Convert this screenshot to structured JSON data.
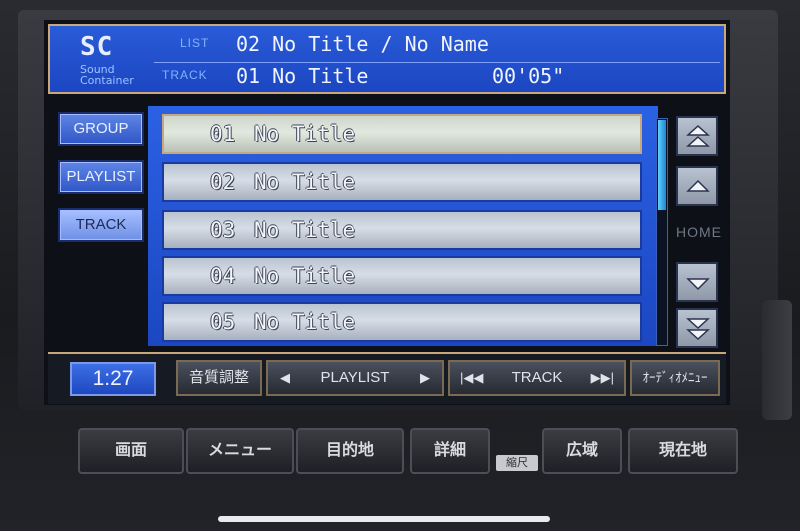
{
  "header": {
    "logo": "SC",
    "logo_sub_1": "Sound",
    "logo_sub_2": "Container",
    "list_label": "LIST",
    "list_value": "02 No Title / No Name",
    "track_label": "TRACK",
    "track_value": "01 No Title",
    "elapsed": "00'05\""
  },
  "sidebar": {
    "items": [
      {
        "label": "GROUP"
      },
      {
        "label": "PLAYLIST"
      },
      {
        "label": "TRACK"
      }
    ],
    "active_index": 2
  },
  "tracks": [
    {
      "num": "01",
      "name": "No Title"
    },
    {
      "num": "02",
      "name": "No Title"
    },
    {
      "num": "03",
      "name": "No Title"
    },
    {
      "num": "04",
      "name": "No Title"
    },
    {
      "num": "05",
      "name": "No Title"
    }
  ],
  "selected_track_index": 0,
  "scroll": {
    "home_label": "HOME"
  },
  "bottom_bar": {
    "clock": "1:27",
    "eq_label": "音質調整",
    "playlist_label": "PLAYLIST",
    "track_label": "TRACK",
    "audio_menu_label": "ｵｰﾃﾞｨｵﾒﾆｭｰ"
  },
  "hardware_buttons": {
    "screen": "画面",
    "menu": "メニュー",
    "destination": "目的地",
    "detail": "詳細",
    "zoom_out": "縮尺",
    "wide": "広域",
    "current_location": "現在地"
  },
  "colors": {
    "header_blue": "#1c46c2",
    "panel_blue": "#2b61e4",
    "accent_gold": "#c9a77a"
  }
}
